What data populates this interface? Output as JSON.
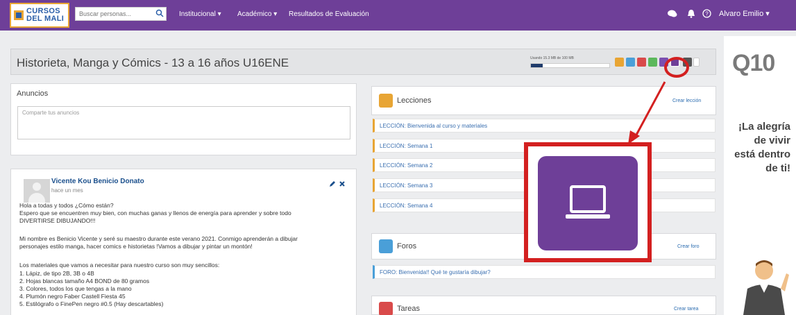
{
  "navbar": {
    "logo_line1": "CURSOS",
    "logo_line2": "DEL MALI",
    "search_placeholder": "Buscar personas...",
    "menu": [
      "Institucional ▾",
      "Académico ▾",
      "Resultados de Evaluación"
    ],
    "user_name": "Alvaro Emilio ▾"
  },
  "course": {
    "title": "Historieta, Manga y Cómics - 13 a 16 años U16ENE",
    "usage_text": "Usando 15.3 MB de 100 MB",
    "usage_fraction": 0.15
  },
  "announcements": {
    "title": "Anuncios",
    "input_placeholder": "Comparte tus anuncios"
  },
  "post": {
    "author": "Vicente Kou Benicio Donato",
    "time_ago": "hace un mes",
    "lines": [
      "Hola a todas y todos ¿Cómo están?",
      "Espero que se encuentren muy bien, con muchas ganas y llenos de energía para aprender y sobre todo",
      "DIVERTIRSE DIBUJANDO!!!",
      "Mi nombre es Benicio Vicente y seré su maestro durante este verano 2021. Conmigo aprenderán a dibujar",
      "personajes estilo manga, hacer comics e historietas !Vamos a dibujar y pintar un montón!",
      "Los materiales que vamos a necesitar para nuestro curso son muy sencillos:",
      "1. Lápiz, de tipo 2B, 3B o 4B",
      "2. Hojas blancas tamaño A4 BOND de 80 gramos",
      "3. Colores, todos los que tengas a la mano",
      "4. Plumón negro Faber Castell Fiesta 45",
      "5. Estilógrafo o FinePen negro #0.5 (Hay descartables)"
    ]
  },
  "lessons": {
    "title": "Lecciones",
    "create_link": "Crear lección",
    "items": [
      "LECCIÓN: Bienvenida al curso y materiales",
      "LECCIÓN: Semana 1",
      "LECCIÓN: Semana 2",
      "LECCIÓN: Semana 3",
      "LECCIÓN: Semana 4"
    ]
  },
  "forums": {
    "title": "Foros",
    "create_link": "Crear foro",
    "items": [
      "FORO: Bienvenida!! Qué te gustaría dibujar?"
    ]
  },
  "tasks": {
    "title": "Tareas",
    "create_link": "Crear tarea"
  },
  "ad": {
    "logo": "Q10",
    "lines": [
      "¡La alegría",
      "de vivir",
      "está dentro",
      "de ti!"
    ]
  },
  "colors": {
    "brand_purple": "#6e3f98",
    "accent_orange": "#e8a534",
    "highlight_red": "#d32020",
    "link_blue": "#2b6cb0"
  },
  "icons": [
    "search-icon",
    "chat-icon",
    "bell-icon",
    "help-icon",
    "laptop-icon",
    "edit-icon",
    "delete-icon"
  ]
}
